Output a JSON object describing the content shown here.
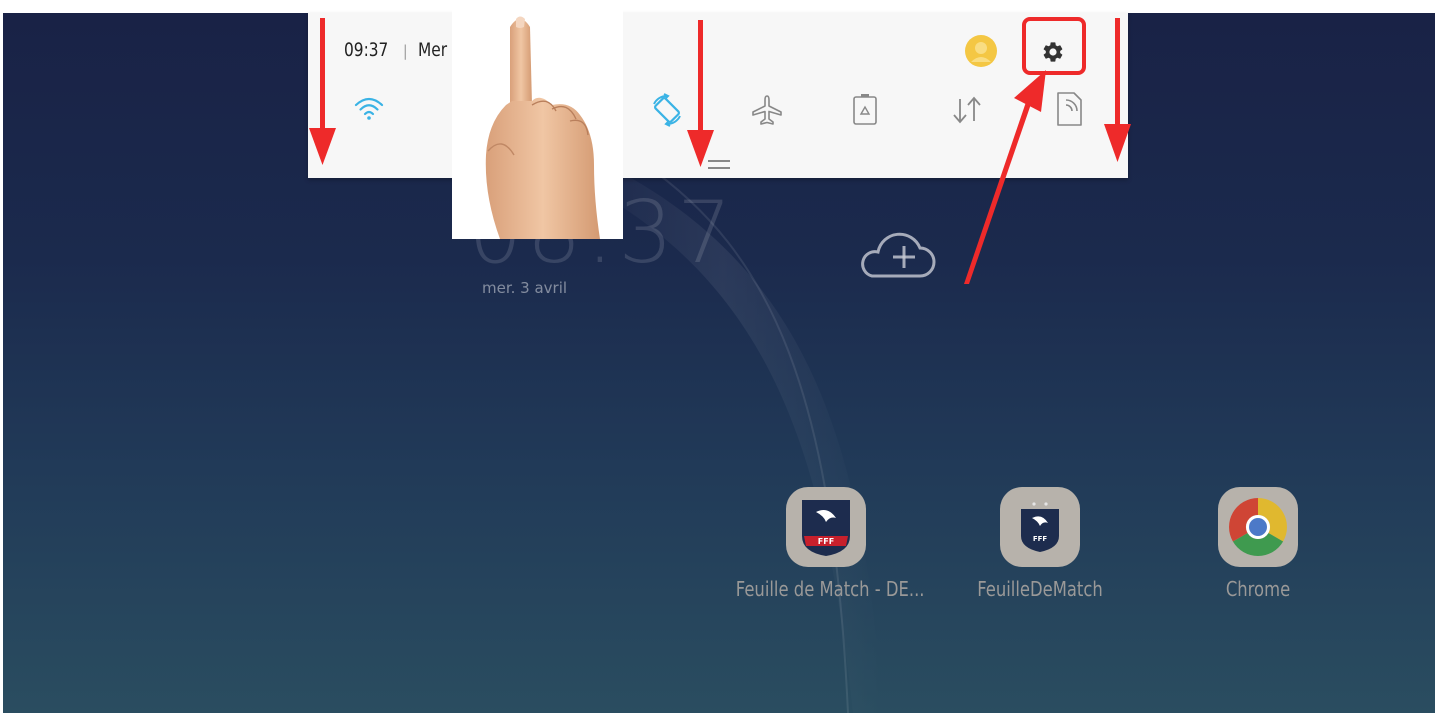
{
  "status_bar": {
    "time": "09:37",
    "separator": "|",
    "day": "Mer"
  },
  "quick_settings": [
    {
      "name": "wifi",
      "state": "on"
    },
    {
      "name": "auto-rotate",
      "state": "on"
    },
    {
      "name": "airplane-mode",
      "state": "off"
    },
    {
      "name": "power-saving",
      "state": "off"
    },
    {
      "name": "mobile-data",
      "state": "off"
    },
    {
      "name": "nfc",
      "state": "off"
    }
  ],
  "home_screen": {
    "date": "mer. 3 avril",
    "apps": [
      {
        "label": "Feuille de Match - DE..."
      },
      {
        "label": "FeuilleDeMatch"
      },
      {
        "label": "Chrome"
      }
    ]
  },
  "colors": {
    "wifi_active": "#3ab3e5",
    "annotation_red": "#ee2a2a",
    "panel_bg": "#f7f7f7"
  }
}
